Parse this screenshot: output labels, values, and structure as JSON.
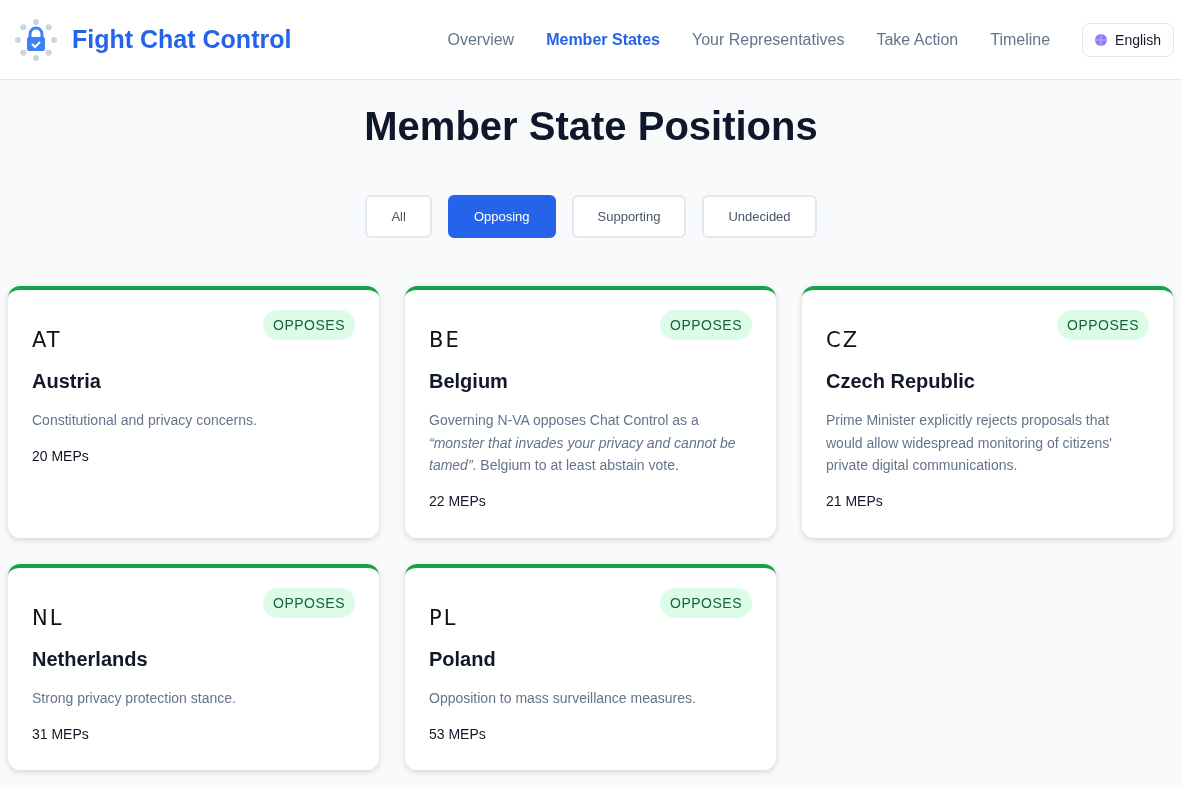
{
  "header": {
    "brand": "Fight Chat Control",
    "nav": [
      {
        "label": "Overview",
        "selected": false
      },
      {
        "label": "Member States",
        "selected": true
      },
      {
        "label": "Your Representatives",
        "selected": false
      },
      {
        "label": "Take Action",
        "selected": false
      },
      {
        "label": "Timeline",
        "selected": false
      }
    ],
    "language": "English"
  },
  "title": "Member State Positions",
  "filters": [
    {
      "label": "All",
      "selected": false
    },
    {
      "label": "Opposing",
      "selected": true
    },
    {
      "label": "Supporting",
      "selected": false
    },
    {
      "label": "Undecided",
      "selected": false
    }
  ],
  "states": [
    {
      "code": "AT",
      "name": "Austria",
      "kind": "opposes",
      "badge": "OPPOSES",
      "description": "Constitutional and privacy concerns.",
      "meps": "20 MEPs"
    },
    {
      "code": "BE",
      "name": "Belgium",
      "kind": "opposes",
      "badge": "OPPOSES",
      "description": "Governing N-VA opposes Chat Control as a *“monster that invades your privacy and cannot be tamed”*. Belgium to at least abstain vote.",
      "meps": "22 MEPs"
    },
    {
      "code": "CZ",
      "name": "Czech Republic",
      "kind": "opposes",
      "badge": "OPPOSES",
      "description": "Prime Minister explicitly rejects proposals that would allow widespread monitoring of citizens' private digital communications.",
      "meps": "21 MEPs"
    },
    {
      "code": "NL",
      "name": "Netherlands",
      "kind": "opposes",
      "badge": "OPPOSES",
      "description": "Strong privacy protection stance.",
      "meps": "31 MEPs"
    },
    {
      "code": "PL",
      "name": "Poland",
      "kind": "opposes",
      "badge": "OPPOSES",
      "description": "Opposition to mass surveillance measures.",
      "meps": "53 MEPs"
    }
  ]
}
